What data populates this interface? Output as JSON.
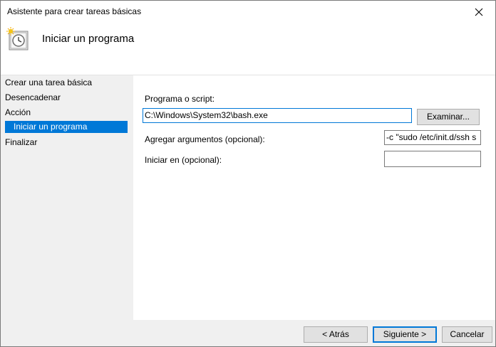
{
  "window": {
    "title": "Asistente para crear tareas básicas"
  },
  "header": {
    "title": "Iniciar un programa",
    "icon": "clock-task-icon"
  },
  "sidebar": {
    "items": [
      {
        "label": "Crear una tarea básica"
      },
      {
        "label": "Desencadenar"
      },
      {
        "label": "Acción"
      },
      {
        "label": "Iniciar un programa",
        "selected": true
      },
      {
        "label": "Finalizar"
      }
    ]
  },
  "form": {
    "program_label": "Programa o script:",
    "program_value": "C:\\Windows\\System32\\bash.exe",
    "browse_label": "Examinar...",
    "args_label": "Agregar argumentos (opcional):",
    "args_value": "-c \"sudo /etc/init.d/ssh s",
    "start_in_label": "Iniciar en (opcional):",
    "start_in_value": ""
  },
  "footer": {
    "back_label": "< Atrás",
    "next_label": "Siguiente >",
    "cancel_label": "Cancelar"
  },
  "colors": {
    "accent": "#0078d7",
    "background": "#f0f0f0"
  }
}
